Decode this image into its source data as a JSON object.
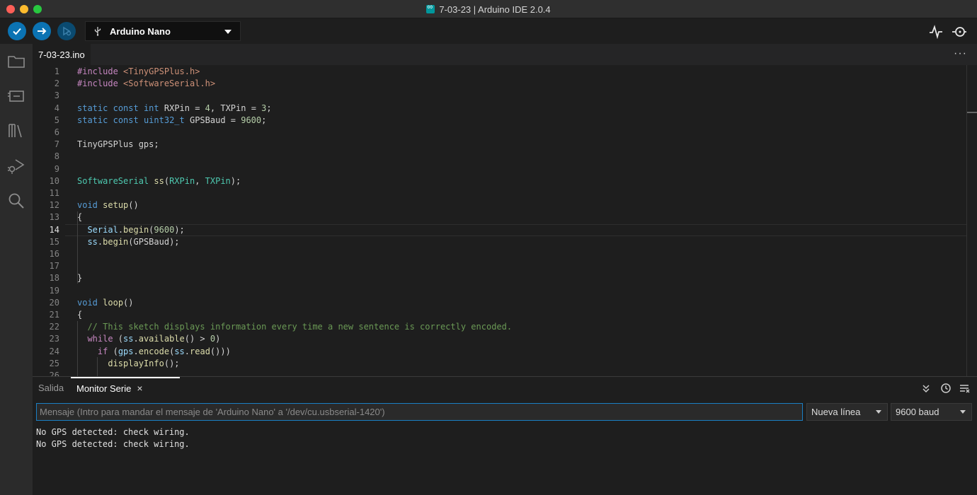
{
  "window": {
    "title": "7-03-23 | Arduino IDE 2.0.4"
  },
  "toolbar": {
    "board": "Arduino Nano"
  },
  "editor": {
    "tab": "7-03-23.ino",
    "more": "···",
    "lines": [
      {
        "n": "1",
        "html": "<span class='pre'>#include</span> <span class='inc'>&lt;TinyGPSPlus.h&gt;</span>"
      },
      {
        "n": "2",
        "html": "<span class='pre'>#include</span> <span class='inc'>&lt;SoftwareSerial.h&gt;</span>"
      },
      {
        "n": "3",
        "html": ""
      },
      {
        "n": "4",
        "html": "<span class='k'>static</span> <span class='k'>const</span> <span class='k'>int</span> RXPin = <span class='num'>4</span>, TXPin = <span class='num'>3</span>;"
      },
      {
        "n": "5",
        "html": "<span class='k'>static</span> <span class='k'>const</span> <span class='k'>uint32_t</span> GPSBaud = <span class='num'>9600</span>;"
      },
      {
        "n": "6",
        "html": ""
      },
      {
        "n": "7",
        "html": "TinyGPSPlus gps;"
      },
      {
        "n": "8",
        "html": ""
      },
      {
        "n": "9",
        "html": ""
      },
      {
        "n": "10",
        "html": "<span class='tp'>SoftwareSerial</span> <span class='fn'>ss</span>(<span class='tp'>RXPin</span>, <span class='tp'>TXPin</span>);"
      },
      {
        "n": "11",
        "html": ""
      },
      {
        "n": "12",
        "html": "<span class='k'>void</span> <span class='fn'>setup</span>()"
      },
      {
        "n": "13",
        "html": "{"
      },
      {
        "n": "14",
        "html": "  <span class='var'>Serial</span>.<span class='fn'>begin</span>(<span class='num'>9600</span>);"
      },
      {
        "n": "15",
        "html": "  <span class='var'>ss</span>.<span class='fn'>begin</span>(GPSBaud);"
      },
      {
        "n": "16",
        "html": ""
      },
      {
        "n": "17",
        "html": ""
      },
      {
        "n": "18",
        "html": "}"
      },
      {
        "n": "19",
        "html": ""
      },
      {
        "n": "20",
        "html": "<span class='k'>void</span> <span class='fn'>loop</span>()"
      },
      {
        "n": "21",
        "html": "{"
      },
      {
        "n": "22",
        "html": "  <span class='cm'>// This sketch displays information every time a new sentence is correctly encoded.</span>"
      },
      {
        "n": "23",
        "html": "  <span class='ctl'>while</span> (<span class='var'>ss</span>.<span class='fn'>available</span>() &gt; <span class='num'>0</span>)"
      },
      {
        "n": "24",
        "html": "    <span class='ctl'>if</span> (<span class='var'>gps</span>.<span class='fn'>encode</span>(<span class='var'>ss</span>.<span class='fn'>read</span>()))"
      },
      {
        "n": "25",
        "html": "      <span class='fn'>displayInfo</span>();"
      },
      {
        "n": "26",
        "html": ""
      }
    ],
    "active_line": "14"
  },
  "panel": {
    "tab_output": "Salida",
    "tab_monitor": "Monitor Serie",
    "close": "×",
    "input_placeholder": "Mensaje (Intro para mandar el mensaje de 'Arduino Nano' a '/dev/cu.usbserial-1420')",
    "line_ending": "Nueva línea",
    "baud": "9600 baud",
    "output": [
      "No GPS detected: check wiring.",
      "No GPS detected: check wiring."
    ]
  }
}
